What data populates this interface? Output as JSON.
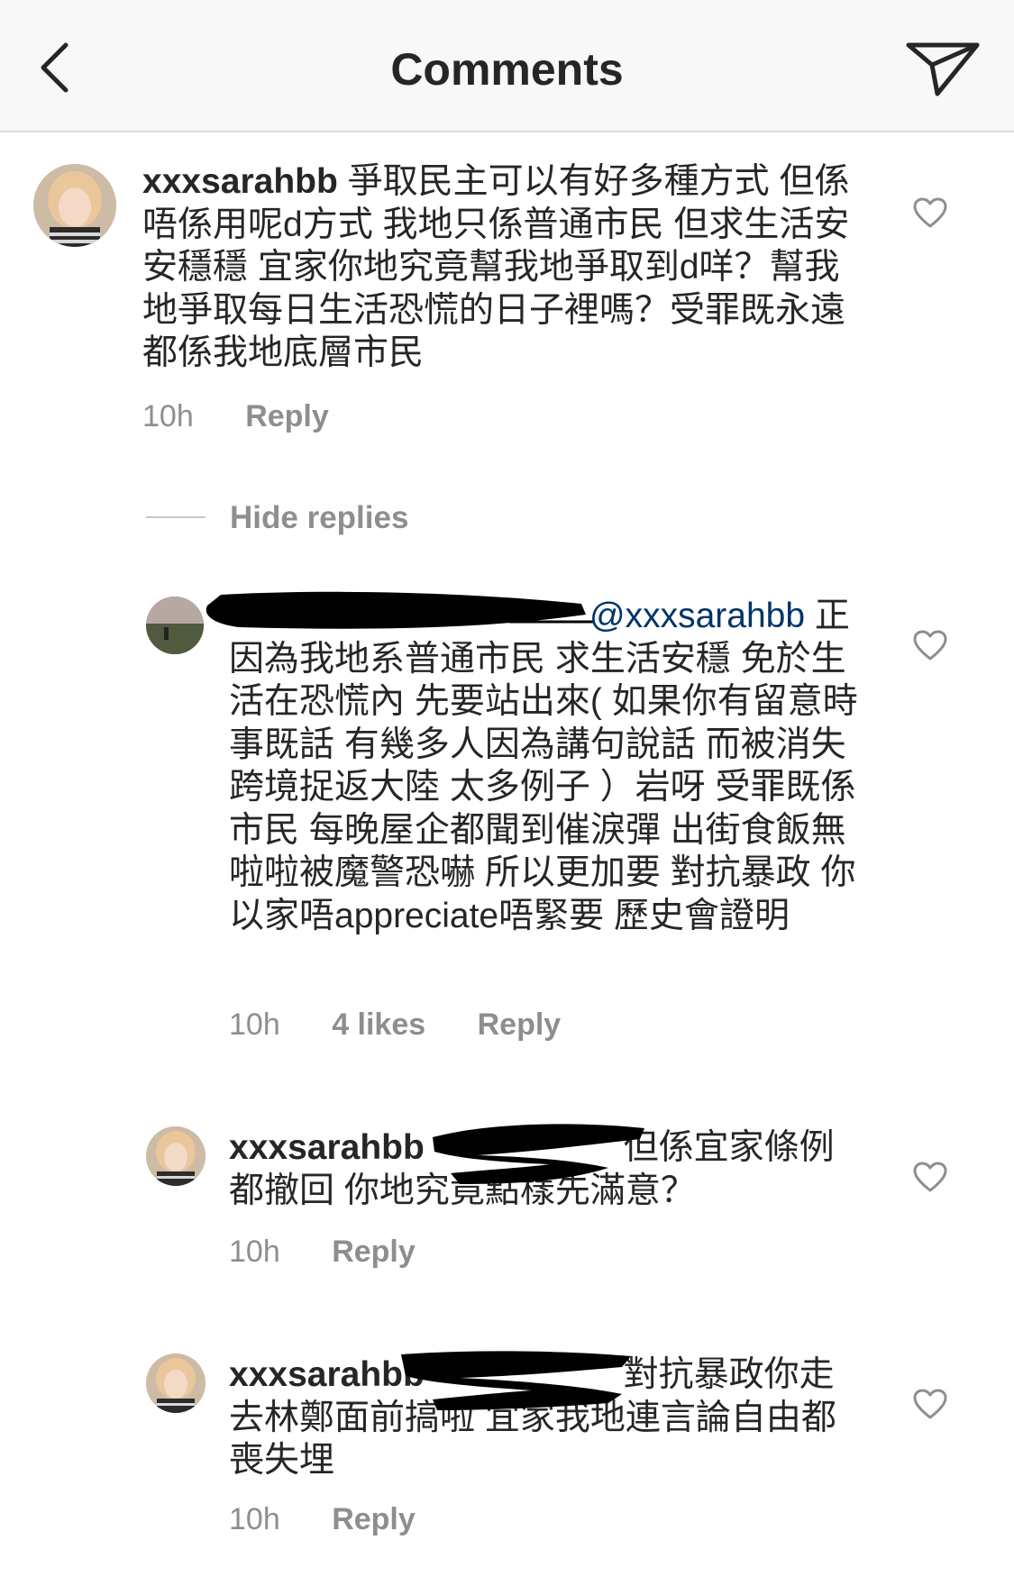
{
  "header": {
    "title": "Comments",
    "back_icon": "chevron-left-icon",
    "send_icon": "paper-plane-icon"
  },
  "comments": [
    {
      "username": "xxxsarahbb",
      "text": "爭取民主可以有好多種方式 但係唔係用呢d方式 我地只係普通市民 但求生活安安穩穩 宜家你地究竟幫我地爭取到d咩？幫我地爭取每日生活恐慌的日子裡嗎？受罪既永遠都係我地底層市民",
      "time": "10h",
      "reply_label": "Reply"
    }
  ],
  "hide_replies_label": "Hide replies",
  "replies": [
    {
      "mention": "@xxxsarahbb",
      "text": "正因為我地系普通市民 求生活安穩 免於生活在恐慌內 先要站出來( 如果你有留意時事既話 有幾多人因為講句說話 而被消失 跨境捉返大陸 太多例子 ）岩呀 受罪既係市民 每晚屋企都聞到催淚彈 出街食飯無啦啦被魔警恐嚇 所以更加要 對抗暴政 你以家唔appreciate唔緊要 歷史會證明",
      "time": "10h",
      "likes": "4 likes",
      "reply_label": "Reply"
    },
    {
      "username": "xxxsarahbb",
      "text": "但係宜家條例都撤回 你地究竟點樣先滿意？",
      "time": "10h",
      "reply_label": "Reply"
    },
    {
      "username": "xxxsarahbb",
      "text": "對抗暴政你走去林鄭面前搞啦 宜家我地連言論自由都喪失埋",
      "time": "10h",
      "reply_label": "Reply"
    }
  ]
}
